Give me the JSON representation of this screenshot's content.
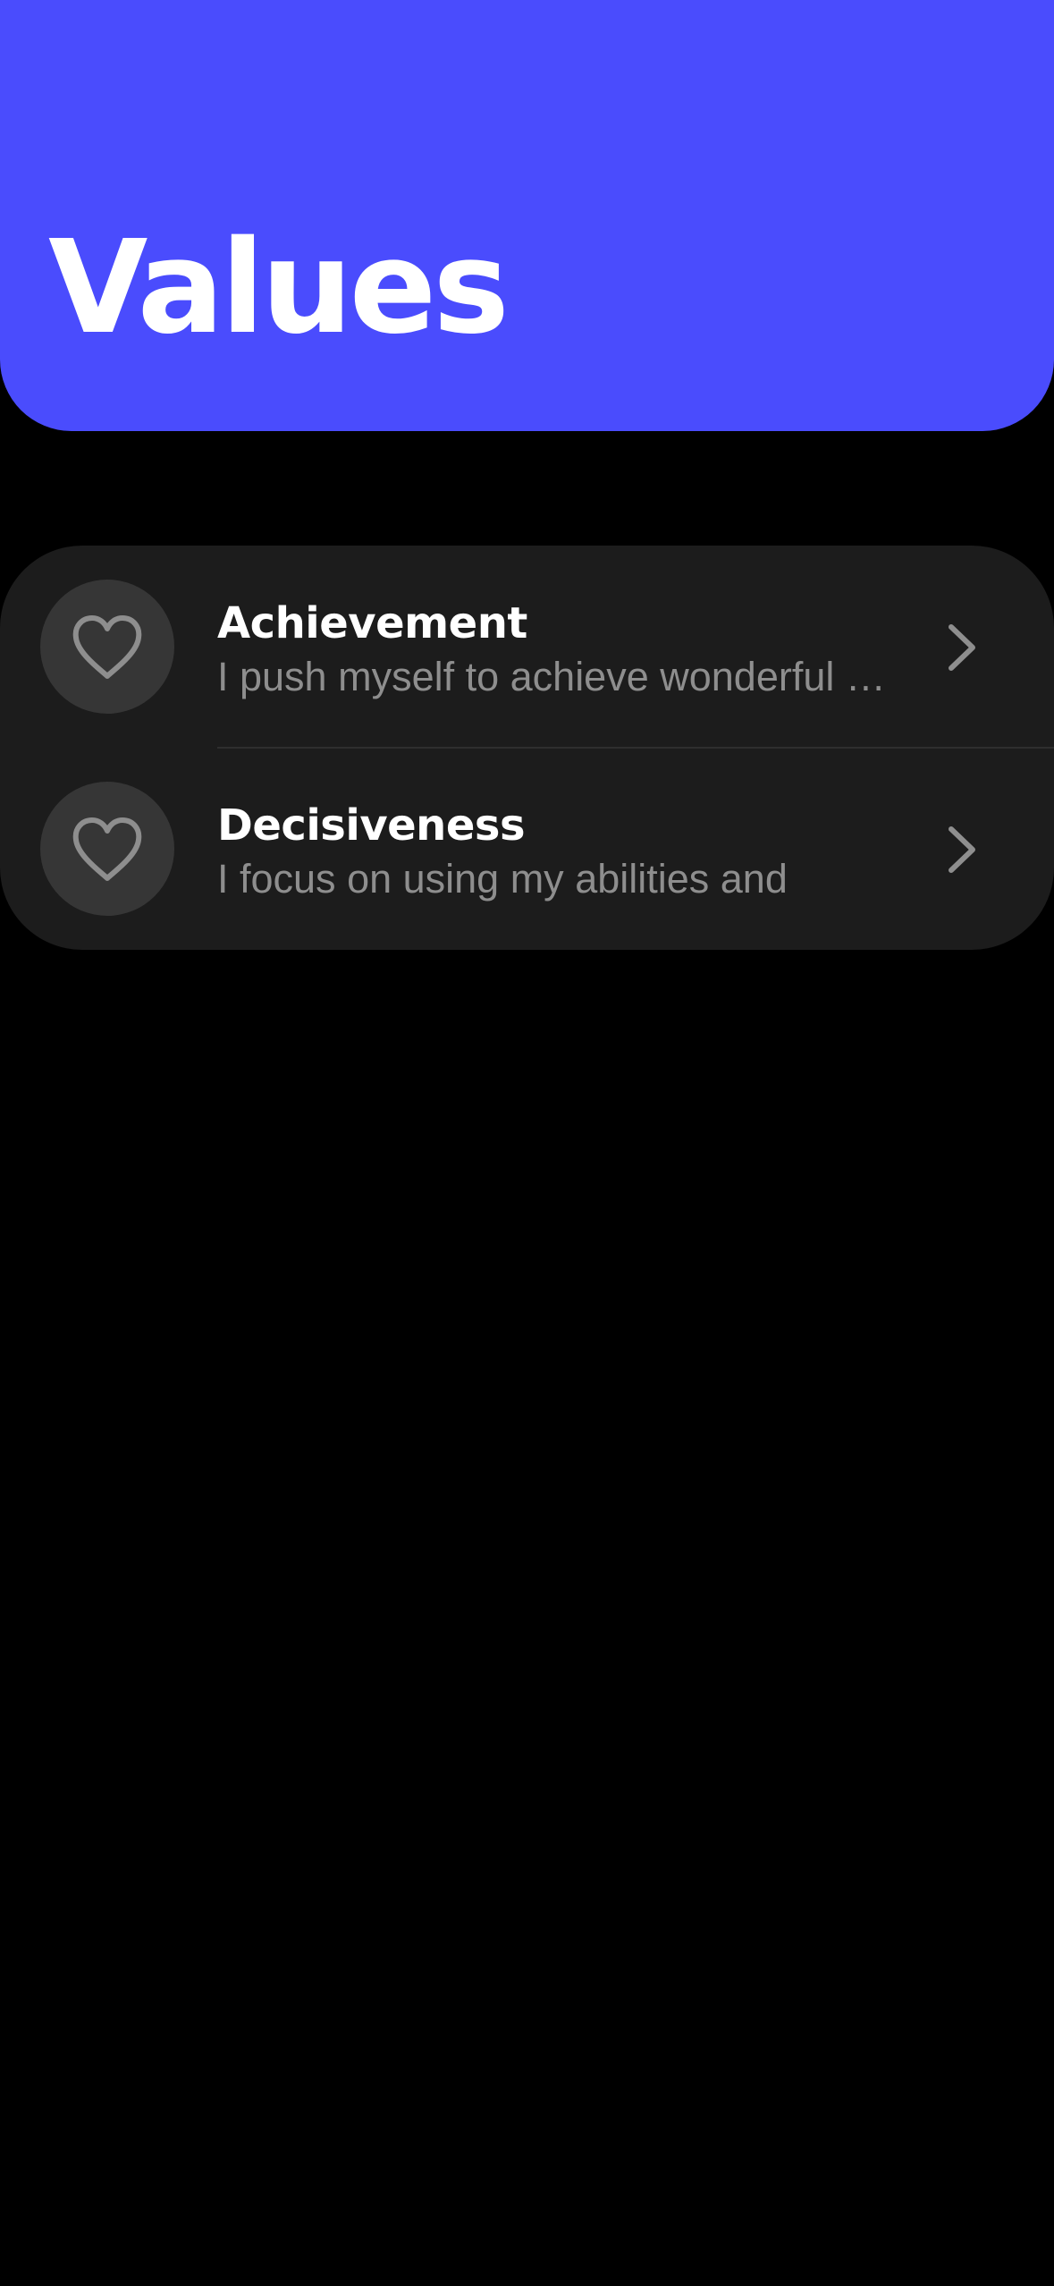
{
  "header": {
    "title": "Values",
    "background_color": "#4a4cfd"
  },
  "values_list": {
    "items": [
      {
        "icon": "heart-outline-icon",
        "title": "Achievement",
        "subtitle": "I push myself to achieve wonderful things",
        "trailing_icon": "chevron-right-icon"
      },
      {
        "icon": "heart-outline-icon",
        "title": "Decisiveness",
        "subtitle": "I focus on using my abilities and",
        "trailing_icon": "chevron-right-icon"
      }
    ]
  }
}
